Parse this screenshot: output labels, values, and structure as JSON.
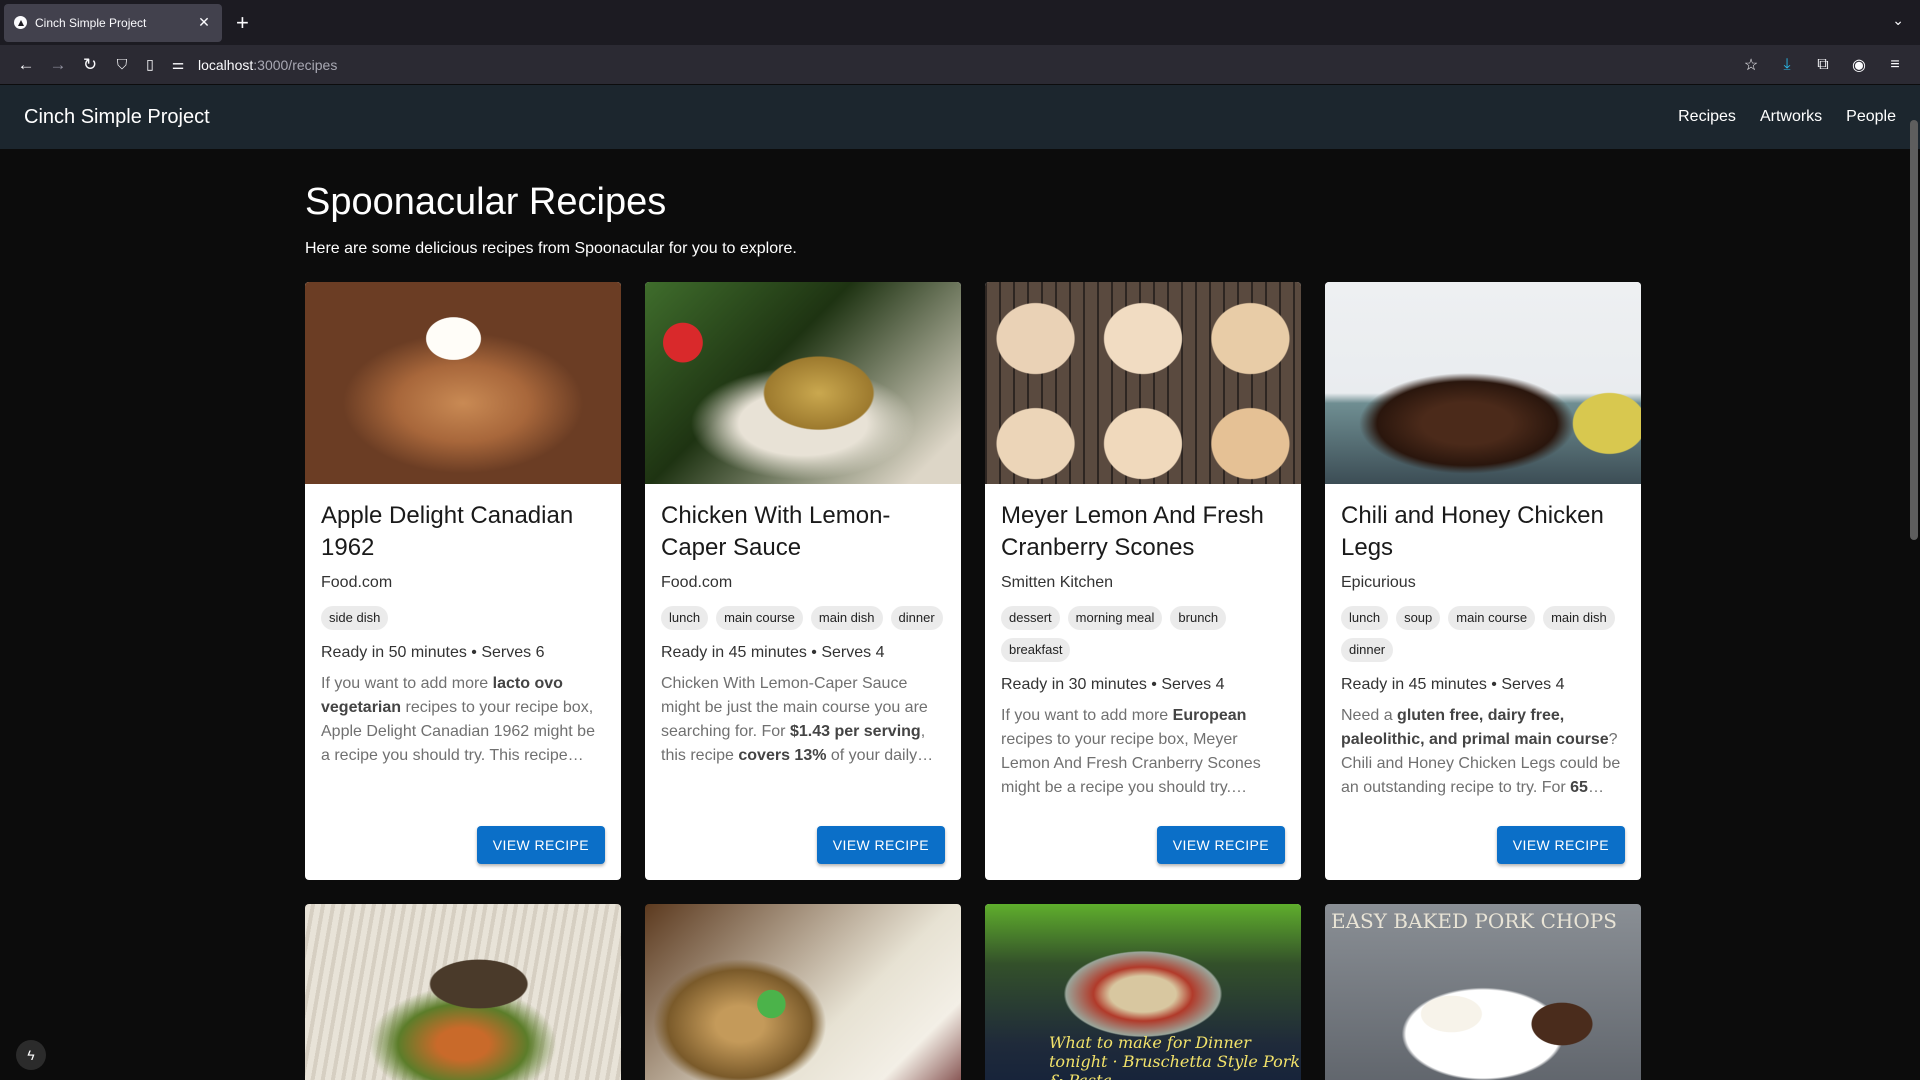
{
  "browser": {
    "tab_title": "Cinch Simple Project",
    "url_host": "localhost",
    "url_path": ":3000/recipes",
    "new_tab_symbol": "+",
    "close_symbol": "✕"
  },
  "app": {
    "brand": "Cinch Simple Project",
    "nav": [
      "Recipes",
      "Artworks",
      "People"
    ]
  },
  "page": {
    "title": "Spoonacular Recipes",
    "subtitle": "Here are some delicious recipes from Spoonacular for you to explore."
  },
  "cards": [
    {
      "title": "Apple Delight Canadian 1962",
      "source": "Food.com",
      "tags": [
        "side dish"
      ],
      "meta": "Ready in 50 minutes • Serves 6",
      "summary_html": "If you want to add more <b>lacto ovo vegetarian</b> recipes to your recipe box, Apple Delight Canadian 1962 might be a recipe you should try. This recipe…",
      "button": "VIEW RECIPE"
    },
    {
      "title": "Chicken With Lemon-Caper Sauce",
      "source": "Food.com",
      "tags": [
        "lunch",
        "main course",
        "main dish",
        "dinner"
      ],
      "meta": "Ready in 45 minutes • Serves 4",
      "summary_html": "Chicken With Lemon-Caper Sauce might be just the main course you are searching for. For <b>$1.43 per serving</b>, this recipe <b>covers 13%</b> of your daily…",
      "button": "VIEW RECIPE"
    },
    {
      "title": "Meyer Lemon And Fresh Cranberry Scones",
      "source": "Smitten Kitchen",
      "tags": [
        "dessert",
        "morning meal",
        "brunch",
        "breakfast"
      ],
      "meta": "Ready in 30 minutes • Serves 4",
      "summary_html": "If you want to add more <b>European</b> recipes to your recipe box, Meyer Lemon And Fresh Cranberry Scones might be a recipe you should try.…",
      "button": "VIEW RECIPE"
    },
    {
      "title": "Chili and Honey Chicken Legs",
      "source": "Epicurious",
      "tags": [
        "lunch",
        "soup",
        "main course",
        "main dish",
        "dinner"
      ],
      "meta": "Ready in 45 minutes • Serves 4",
      "summary_html": "Need a <b>gluten free, dairy free, paleolithic, and primal main course</b>? Chili and Honey Chicken Legs could be an outstanding recipe to try. For <b>65</b>…",
      "button": "VIEW RECIPE"
    }
  ],
  "second_row_captions": {
    "card7": "What to make for Dinner tonight · Bruschetta Style Pork & Pasta",
    "card8": "EASY BAKED PORK CHOPS"
  }
}
